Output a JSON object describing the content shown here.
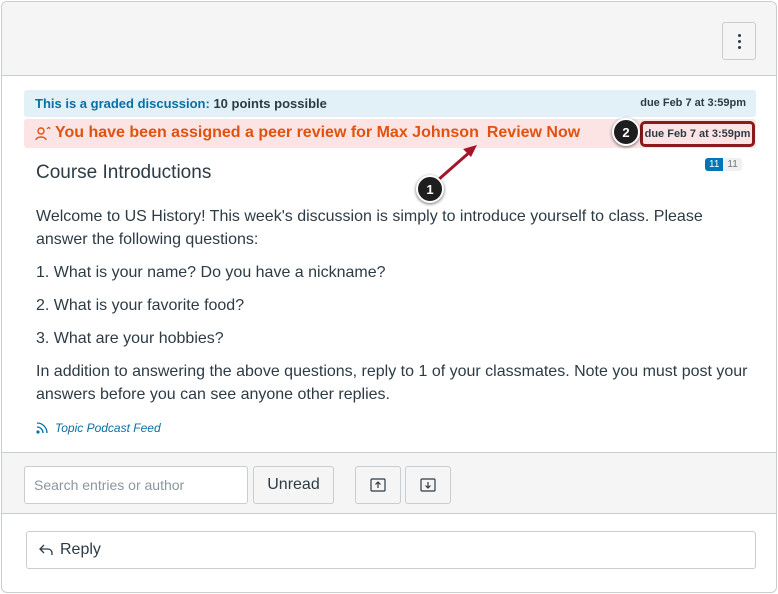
{
  "header": {
    "more_menu_icon": "kebab-vertical-icon"
  },
  "graded": {
    "label": "This is a graded discussion:",
    "points": "10 points possible",
    "due": "due Feb 7 at 3:59pm"
  },
  "peer_review": {
    "icon": "peer-review-icon",
    "message": "You have been assigned a peer review for Max Johnson",
    "link": "Review Now",
    "due": "due Feb 7 at 3:59pm"
  },
  "topic": {
    "title": "Course Introductions",
    "unread_count": "11",
    "total_count": "11",
    "paragraphs": [
      "Welcome to US History! This week's discussion is simply to introduce yourself to class. Please answer the following questions:",
      "1. What is your name? Do you have a nickname?",
      "2. What is your favorite food?",
      "3. What are your hobbies?",
      "In addition to answering the above questions, reply to 1 of your classmates. Note you must post your answers before you can see anyone other replies."
    ],
    "podcast_link": "Topic Podcast Feed"
  },
  "toolbar": {
    "search_placeholder": "Search entries or author",
    "unread_label": "Unread",
    "collapse_icon": "collapse-up-icon",
    "expand_icon": "expand-down-icon"
  },
  "reply": {
    "label": "Reply",
    "icon": "reply-arrow-icon"
  },
  "callouts": [
    "1",
    "2"
  ],
  "colors": {
    "accent": "#0770a3",
    "warning": "#e0520f",
    "highlight": "#8b1a1a"
  }
}
